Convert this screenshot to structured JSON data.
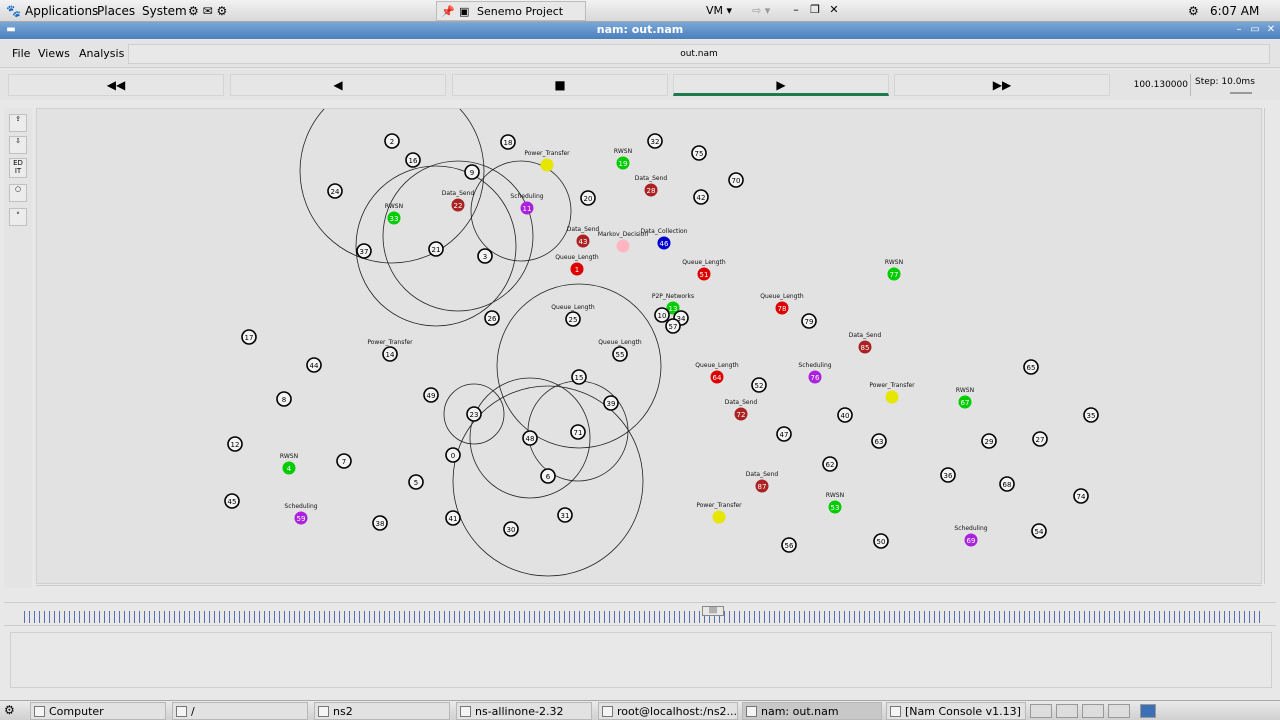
{
  "top_panel": {
    "menus": [
      "Applications",
      "Places",
      "System"
    ],
    "active_task": "Senemo Project",
    "vm_label": "VM",
    "clock": "6:07 AM"
  },
  "window": {
    "title": "nam: out.nam"
  },
  "menu_bar": {
    "items": [
      "File",
      "Views",
      "Analysis"
    ],
    "file_name": "out.nam"
  },
  "controls": {
    "rewind": "◀◀",
    "back": "◀",
    "stop": "■",
    "play": "▶",
    "fast_forward": "▶▶",
    "time": "100.130000",
    "step": "Step: 10.0ms"
  },
  "tools": {
    "edit_label": "ED IT"
  },
  "timeline": {
    "marker_label": "||||"
  },
  "nodes": [
    {
      "id": "2",
      "color": "#000000",
      "label": ""
    },
    {
      "id": "16",
      "color": "#000000",
      "label": ""
    },
    {
      "id": "18",
      "color": "#000000",
      "label": ""
    },
    {
      "id": "9",
      "color": "#000000",
      "label": ""
    },
    {
      "id": "24",
      "color": "#000000",
      "label": ""
    },
    {
      "id": "33",
      "color": "#00cc00",
      "label": "RWSN"
    },
    {
      "id": "22",
      "color": "#aa2222",
      "label": "Data_Send"
    },
    {
      "id": "37",
      "color": "#000000",
      "label": ""
    },
    {
      "id": "21",
      "color": "#000000",
      "label": ""
    },
    {
      "id": "3",
      "color": "#000000",
      "label": ""
    },
    {
      "id": "26",
      "color": "#000000",
      "label": ""
    },
    {
      "id": "P1",
      "color": "#e6e600",
      "label": "Power_Transfer"
    },
    {
      "id": "11",
      "color": "#aa22dd",
      "label": "Scheduling"
    },
    {
      "id": "20",
      "color": "#000000",
      "label": ""
    },
    {
      "id": "19",
      "color": "#00cc00",
      "label": "RWSN"
    },
    {
      "id": "32",
      "color": "#000000",
      "label": ""
    },
    {
      "id": "28",
      "color": "#aa2222",
      "label": "Data_Send"
    },
    {
      "id": "75",
      "color": "#000000",
      "label": ""
    },
    {
      "id": "70",
      "color": "#000000",
      "label": ""
    },
    {
      "id": "42",
      "color": "#000000",
      "label": ""
    },
    {
      "id": "43",
      "color": "#aa2222",
      "label": "Data_Send"
    },
    {
      "id": "M",
      "color": "#ffb6c1",
      "label": "Markov_Decision"
    },
    {
      "id": "46",
      "color": "#0000cc",
      "label": "Data_Collection"
    },
    {
      "id": "1",
      "color": "#dd0000",
      "label": "Queue_Length"
    },
    {
      "id": "51",
      "color": "#dd0000",
      "label": "Queue_Length"
    },
    {
      "id": "77",
      "color": "#00cc00",
      "label": "RWSN"
    },
    {
      "id": "13",
      "color": "#00cc00",
      "label": "P2P_Networks"
    },
    {
      "id": "10",
      "color": "#000000",
      "label": ""
    },
    {
      "id": "34",
      "color": "#000000",
      "label": ""
    },
    {
      "id": "57",
      "color": "#000000",
      "label": ""
    },
    {
      "id": "78",
      "color": "#dd0000",
      "label": "Queue_Length"
    },
    {
      "id": "25",
      "color": "#000000",
      "label": "Queue_Length"
    },
    {
      "id": "17",
      "color": "#000000",
      "label": ""
    },
    {
      "id": "44",
      "color": "#000000",
      "label": ""
    },
    {
      "id": "14",
      "color": "#000000",
      "label": "Power_Transfer"
    },
    {
      "id": "55",
      "color": "#000000",
      "label": "Queue_Length"
    },
    {
      "id": "85",
      "color": "#aa2222",
      "label": "Data_Send"
    },
    {
      "id": "8",
      "color": "#000000",
      "label": ""
    },
    {
      "id": "49",
      "color": "#000000",
      "label": ""
    },
    {
      "id": "15",
      "color": "#000000",
      "label": ""
    },
    {
      "id": "39",
      "color": "#000000",
      "label": ""
    },
    {
      "id": "23",
      "color": "#000000",
      "label": ""
    },
    {
      "id": "64",
      "color": "#dd0000",
      "label": "Queue_Length"
    },
    {
      "id": "52",
      "color": "#000000",
      "label": ""
    },
    {
      "id": "76",
      "color": "#aa22dd",
      "label": "Scheduling"
    },
    {
      "id": "P2",
      "color": "#e6e600",
      "label": "Power_Transfer"
    },
    {
      "id": "67",
      "color": "#00cc00",
      "label": "RWSN"
    },
    {
      "id": "65",
      "color": "#000000",
      "label": ""
    },
    {
      "id": "35",
      "color": "#000000",
      "label": ""
    },
    {
      "id": "12",
      "color": "#000000",
      "label": ""
    },
    {
      "id": "48",
      "color": "#000000",
      "label": ""
    },
    {
      "id": "71",
      "color": "#000000",
      "label": ""
    },
    {
      "id": "72",
      "color": "#aa2222",
      "label": "Data_Send"
    },
    {
      "id": "40",
      "color": "#000000",
      "label": ""
    },
    {
      "id": "47",
      "color": "#000000",
      "label": ""
    },
    {
      "id": "4",
      "color": "#00cc00",
      "label": "RWSN"
    },
    {
      "id": "7",
      "color": "#000000",
      "label": ""
    },
    {
      "id": "0",
      "color": "#000000",
      "label": ""
    },
    {
      "id": "6",
      "color": "#000000",
      "label": ""
    },
    {
      "id": "63",
      "color": "#000000",
      "label": ""
    },
    {
      "id": "62",
      "color": "#000000",
      "label": ""
    },
    {
      "id": "29",
      "color": "#000000",
      "label": ""
    },
    {
      "id": "27",
      "color": "#000000",
      "label": ""
    },
    {
      "id": "36",
      "color": "#000000",
      "label": ""
    },
    {
      "id": "5",
      "color": "#000000",
      "label": ""
    },
    {
      "id": "68",
      "color": "#000000",
      "label": ""
    },
    {
      "id": "74",
      "color": "#000000",
      "label": ""
    },
    {
      "id": "41",
      "color": "#000000",
      "label": ""
    },
    {
      "id": "87",
      "color": "#aa2222",
      "label": "Data_Send"
    },
    {
      "id": "45",
      "color": "#000000",
      "label": ""
    },
    {
      "id": "53",
      "color": "#00cc00",
      "label": "RWSN"
    },
    {
      "id": "38",
      "color": "#000000",
      "label": ""
    },
    {
      "id": "30",
      "color": "#000000",
      "label": ""
    },
    {
      "id": "59",
      "color": "#aa22dd",
      "label": "Scheduling"
    },
    {
      "id": "31",
      "color": "#000000",
      "label": ""
    },
    {
      "id": "56",
      "color": "#000000",
      "label": ""
    },
    {
      "id": "50",
      "color": "#000000",
      "label": ""
    },
    {
      "id": "69",
      "color": "#aa22dd",
      "label": "Scheduling"
    },
    {
      "id": "54",
      "color": "#000000",
      "label": ""
    },
    {
      "id": "P3",
      "color": "#e6e600",
      "label": "Power_Transfer"
    },
    {
      "id": "79",
      "color": "#000000",
      "label": ""
    }
  ],
  "bottom_panel": {
    "tasks": [
      "Computer",
      "/",
      "ns2",
      "ns-allinone-2.32",
      "root@localhost:/ns2...",
      "nam: out.nam",
      "[Nam Console v1.13]"
    ]
  }
}
